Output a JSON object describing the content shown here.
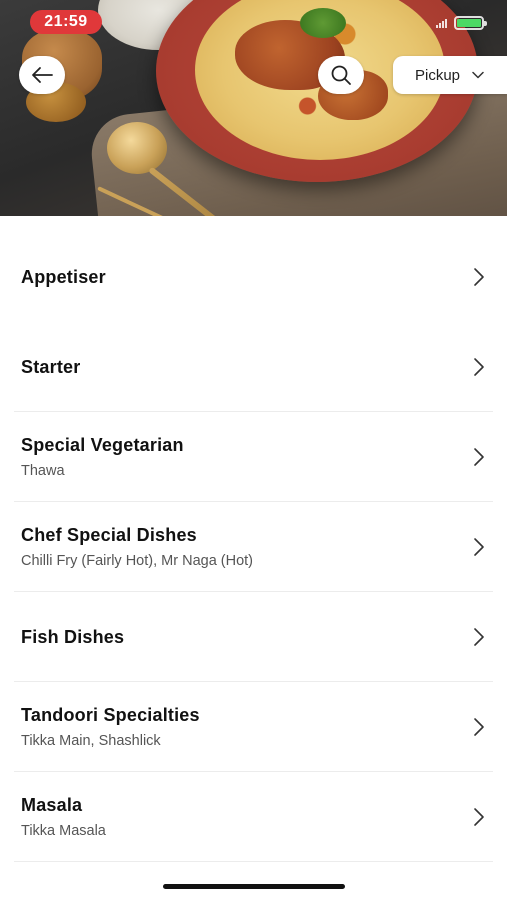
{
  "status_bar": {
    "time": "21:59",
    "time_pill_color": "#e0383a",
    "battery_color": "#4cd964",
    "battery_level": 1.0
  },
  "header": {
    "back_icon": "arrow-left-icon",
    "search_icon": "search-icon",
    "pickup_label": "Pickup",
    "pickup_icon": "chevron-down-icon"
  },
  "categories": [
    {
      "title": "Appetiser",
      "subtitle": ""
    },
    {
      "title": "Starter",
      "subtitle": ""
    },
    {
      "title": "Special Vegetarian",
      "subtitle": "Thawa"
    },
    {
      "title": "Chef Special Dishes",
      "subtitle": "Chilli Fry (Fairly Hot), Mr Naga (Hot)"
    },
    {
      "title": "Fish Dishes",
      "subtitle": ""
    },
    {
      "title": "Tandoori Specialties",
      "subtitle": "Tikka Main, Shashlick"
    },
    {
      "title": "Masala",
      "subtitle": "Tikka Masala"
    }
  ],
  "row_icon": "chevron-right-icon"
}
